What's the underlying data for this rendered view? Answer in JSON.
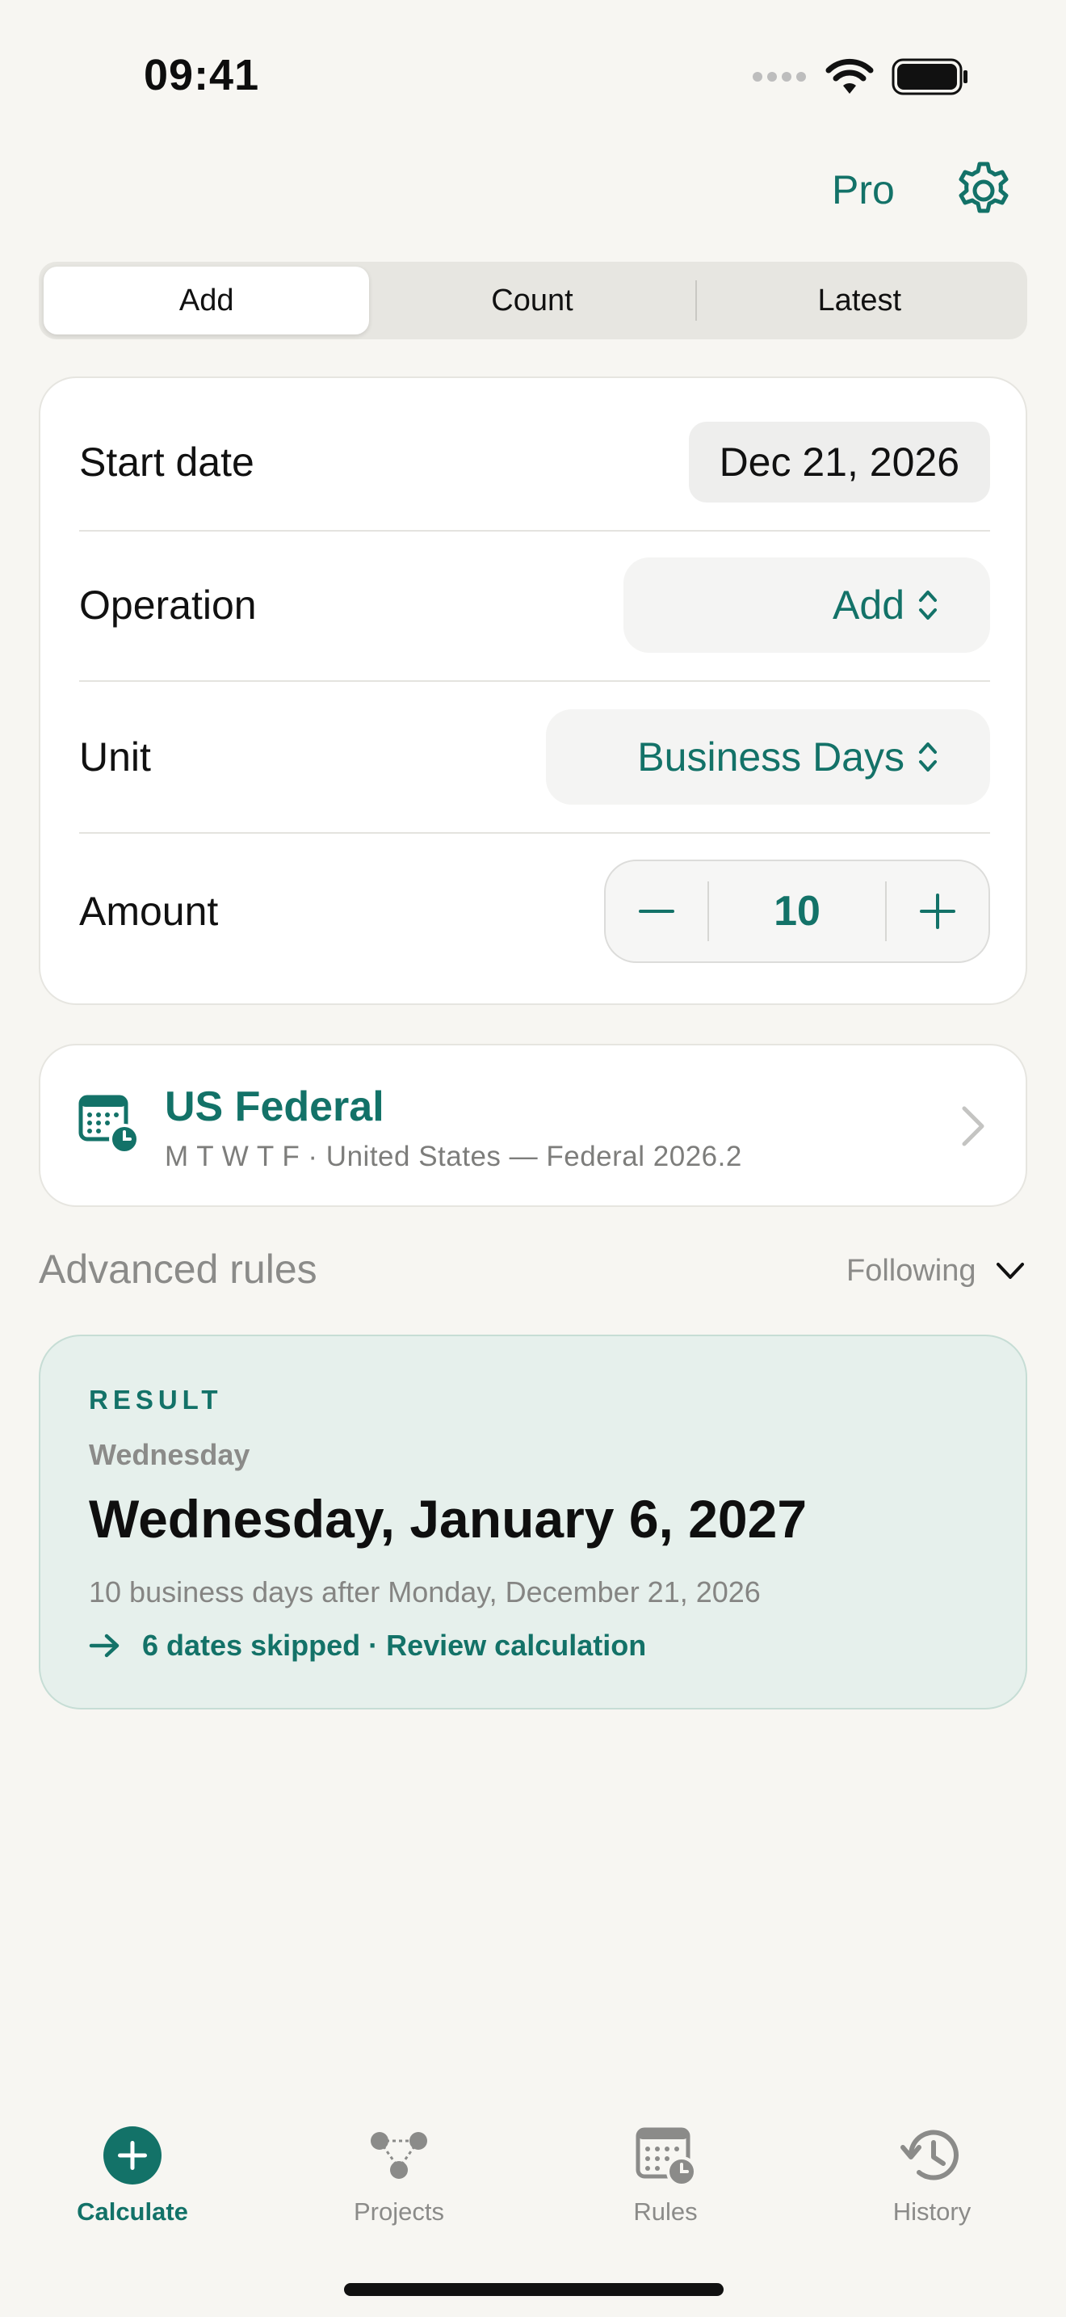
{
  "status_bar": {
    "time": "09:41"
  },
  "top_nav": {
    "pro_label": "Pro"
  },
  "segments": [
    {
      "label": "Add",
      "active": true
    },
    {
      "label": "Count",
      "active": false
    },
    {
      "label": "Latest",
      "active": false
    }
  ],
  "form": {
    "start_date": {
      "label": "Start date",
      "value": "Dec 21, 2026"
    },
    "operation": {
      "label": "Operation",
      "value": "Add"
    },
    "unit": {
      "label": "Unit",
      "value": "Business Days"
    },
    "amount": {
      "label": "Amount",
      "value": "10"
    }
  },
  "calendar_rule": {
    "title": "US Federal",
    "subtitle": "M T W T F · United States — Federal 2026.2"
  },
  "advanced_rules": {
    "label": "Advanced rules",
    "mode": "Following"
  },
  "result": {
    "heading": "RESULT",
    "weekday": "Wednesday",
    "date": "Wednesday, January 6, 2027",
    "description": "10 business days after Monday, December 21, 2026",
    "link": "6 dates skipped · Review calculation"
  },
  "tab_bar": {
    "items": [
      {
        "label": "Calculate",
        "icon": "plus-circle-icon",
        "active": true
      },
      {
        "label": "Projects",
        "icon": "projects-graph-icon",
        "active": false
      },
      {
        "label": "Rules",
        "icon": "calendar-clock-icon",
        "active": false
      },
      {
        "label": "History",
        "icon": "history-clock-icon",
        "active": false
      }
    ]
  },
  "colors": {
    "accent": "#137268",
    "background": "#f7f6f2",
    "result_bg": "#e6f0ec"
  }
}
